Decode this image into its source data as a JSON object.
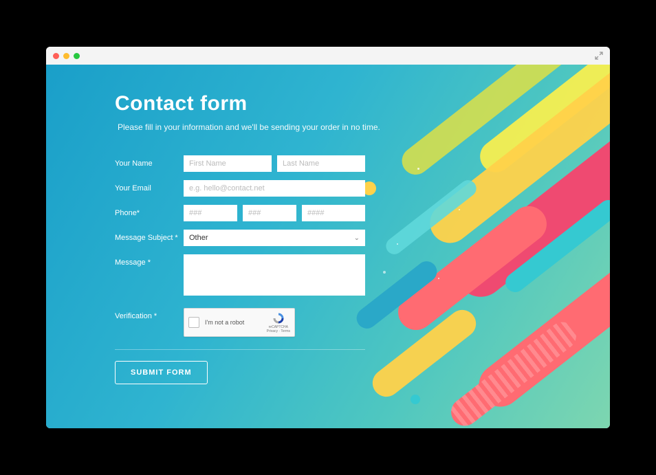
{
  "header": {
    "title": "Contact form",
    "subtitle": "Please fill in your information and we'll be sending your order in no time."
  },
  "labels": {
    "name": "Your Name",
    "email": "Your Email",
    "phone": "Phone*",
    "subject": "Message Subject *",
    "message": "Message *",
    "verification": "Verification *"
  },
  "placeholders": {
    "first_name": "First Name",
    "last_name": "Last Name",
    "email": "e.g. hello@contact.net",
    "phone_a": "###",
    "phone_b": "###",
    "phone_c": "####"
  },
  "subject_selected": "Other",
  "captcha": {
    "text": "I'm not a robot",
    "brand": "reCAPTCHA",
    "legal": "Privacy · Terms"
  },
  "submit_label": "SUBMIT FORM"
}
